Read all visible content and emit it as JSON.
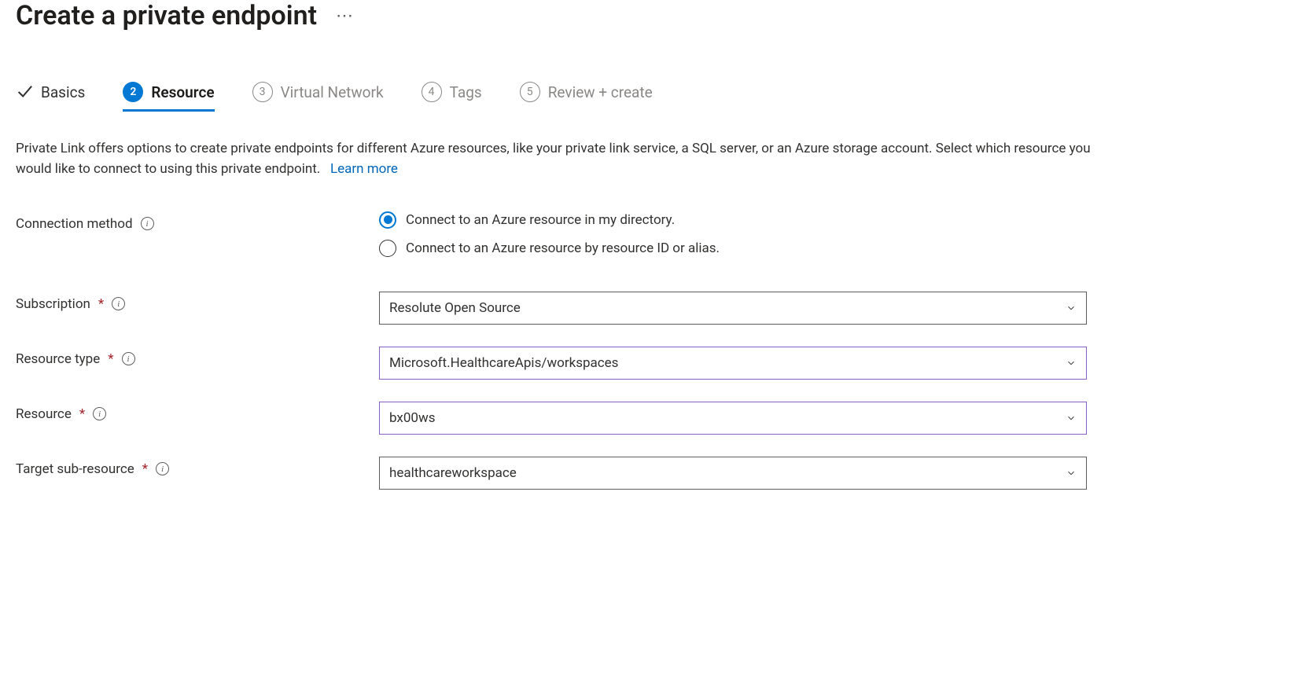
{
  "page": {
    "title": "Create a private endpoint"
  },
  "tabs": {
    "basics": "Basics",
    "resource": {
      "num": "2",
      "label": "Resource"
    },
    "vnet": {
      "num": "3",
      "label": "Virtual Network"
    },
    "tags": {
      "num": "4",
      "label": "Tags"
    },
    "review": {
      "num": "5",
      "label": "Review + create"
    }
  },
  "description": {
    "text": "Private Link offers options to create private endpoints for different Azure resources, like your private link service, a SQL server, or an Azure storage account. Select which resource you would like to connect to using this private endpoint.",
    "learn_more": "Learn more"
  },
  "form": {
    "connection_method": {
      "label": "Connection method",
      "option1": "Connect to an Azure resource in my directory.",
      "option2": "Connect to an Azure resource by resource ID or alias."
    },
    "subscription": {
      "label": "Subscription",
      "value": "Resolute Open Source"
    },
    "resource_type": {
      "label": "Resource type",
      "value": "Microsoft.HealthcareApis/workspaces"
    },
    "resource": {
      "label": "Resource",
      "value": "bx00ws"
    },
    "target_sub_resource": {
      "label": "Target sub-resource",
      "value": "healthcareworkspace"
    }
  }
}
